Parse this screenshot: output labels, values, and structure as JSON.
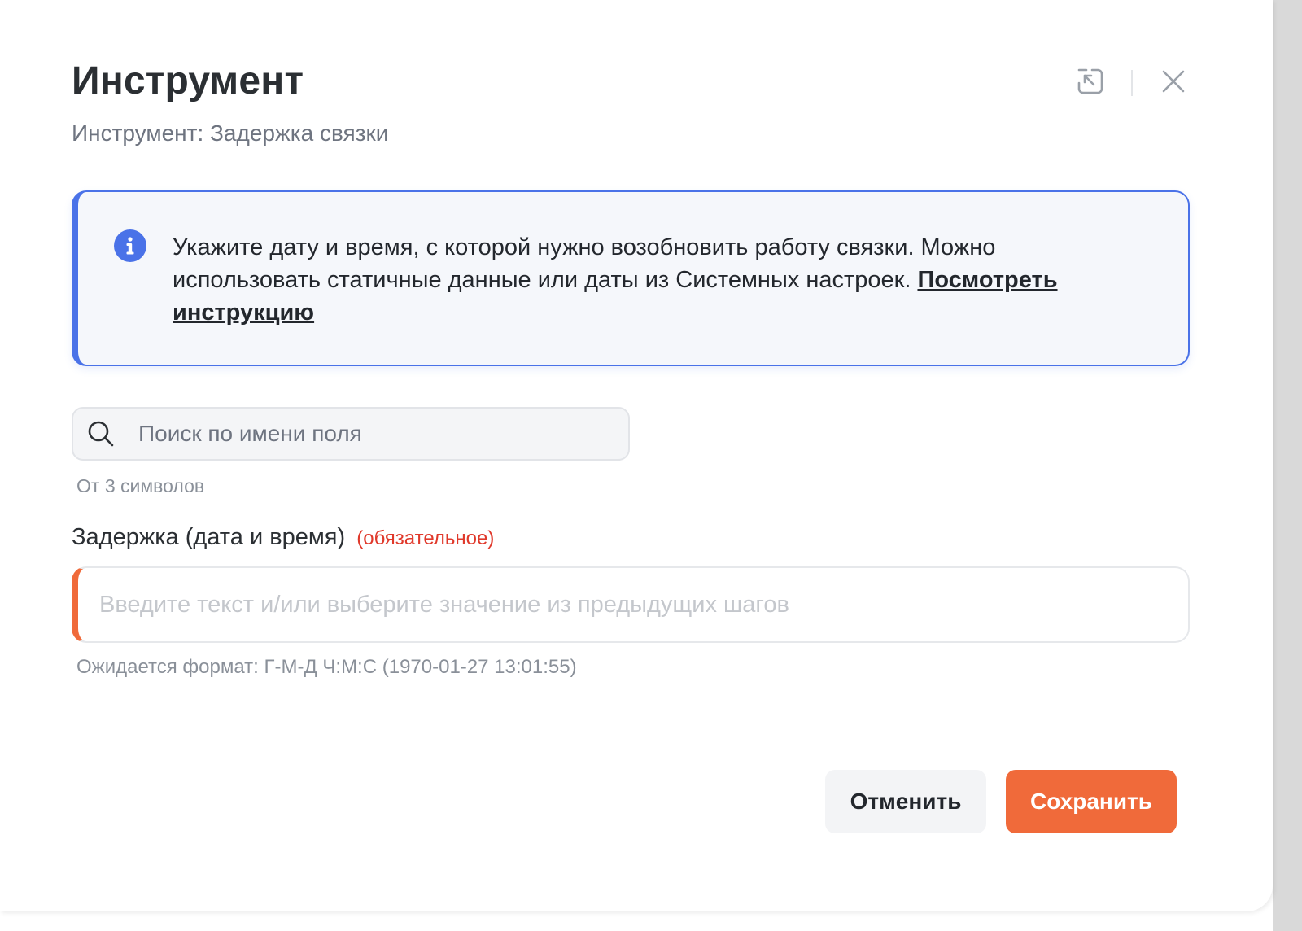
{
  "dialog": {
    "title": "Инструмент",
    "subtitle": "Инструмент: Задержка связки"
  },
  "header_actions": {
    "collapse_icon": "arrow-into-box-icon",
    "close_icon": "close-icon"
  },
  "info": {
    "icon": "info-icon",
    "text": "Укажите дату и время, с которой нужно возобновить работу связки. Можно использовать статичные данные или даты из Системных настроек. ",
    "link_label": "Посмотреть инструкцию"
  },
  "search": {
    "icon": "search-icon",
    "placeholder": "Поиск по имени поля",
    "value": "",
    "hint": "От 3 символов"
  },
  "delay_field": {
    "label": "Задержка (дата и время)",
    "required_label": "(обязательное)",
    "placeholder": "Введите текст и/или выберите значение из предыдущих шагов",
    "value": "",
    "format_hint": "Ожидается формат: Г-М-Д Ч:М:С (1970-01-27 13:01:55)"
  },
  "footer": {
    "cancel_label": "Отменить",
    "save_label": "Сохранить"
  },
  "colors": {
    "accent": "#f06a3a",
    "info": "#4a72e8",
    "required": "#e0392b"
  }
}
